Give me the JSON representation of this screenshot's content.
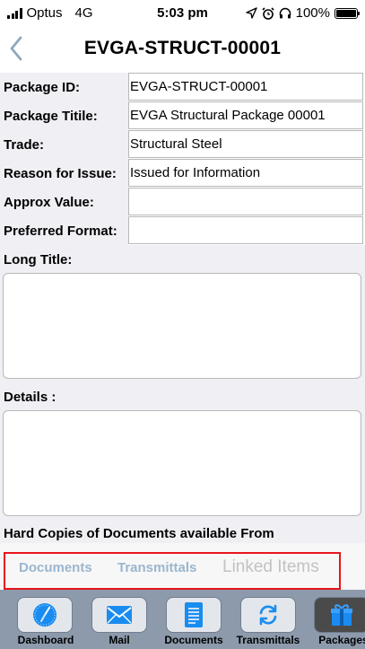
{
  "status_bar": {
    "carrier": "Optus",
    "network": "4G",
    "time": "5:03 pm",
    "battery": "100%"
  },
  "nav": {
    "title": "EVGA-STRUCT-00001"
  },
  "form": {
    "fields": [
      {
        "label": "Package ID:",
        "value": "EVGA-STRUCT-00001"
      },
      {
        "label": "Package Titile:",
        "value": "EVGA Structural Package 00001"
      },
      {
        "label": "Trade:",
        "value": "Structural Steel"
      },
      {
        "label": "Reason for Issue:",
        "value": "Issued for Information"
      },
      {
        "label": "Approx Value:",
        "value": ""
      },
      {
        "label": "Preferred Format:",
        "value": ""
      }
    ],
    "long_title_label": "Long Title:",
    "long_title_value": "",
    "details_label": "Details :",
    "details_value": "",
    "hard_copies_label": "Hard Copies of Documents available From"
  },
  "tabs": {
    "documents": "Documents",
    "transmittals": "Transmittals",
    "linked_items": "Linked Items",
    "highlight_color": "#e8151b"
  },
  "toolbar": {
    "items": [
      {
        "label": "Dashboard",
        "icon": "compass-icon"
      },
      {
        "label": "Mail",
        "icon": "envelope-icon"
      },
      {
        "label": "Documents",
        "icon": "document-icon"
      },
      {
        "label": "Transmittals",
        "icon": "sync-icon"
      },
      {
        "label": "Packages",
        "icon": "gift-icon",
        "active": true
      }
    ],
    "background": "#8c9aac",
    "accent": "#1a8cf0"
  }
}
